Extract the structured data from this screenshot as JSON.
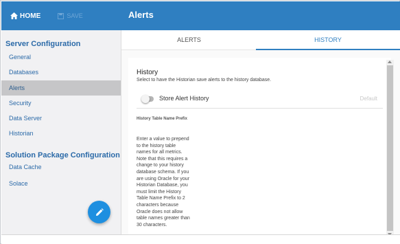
{
  "topbar": {
    "home_label": "HOME",
    "save_label": "SAVE",
    "page_title": "Alerts"
  },
  "sidebar": {
    "sections": [
      {
        "title": "Server Configuration"
      },
      {
        "title": "Solution Package Configuration"
      }
    ],
    "items": [
      {
        "label": "General"
      },
      {
        "label": "Databases"
      },
      {
        "label": "Alerts"
      },
      {
        "label": "Security"
      },
      {
        "label": "Data Server"
      },
      {
        "label": "Historian"
      },
      {
        "label": "Data Cache"
      },
      {
        "label": "Solace"
      }
    ],
    "fab_icon": "pencil-icon"
  },
  "tabs": [
    {
      "label": "ALERTS"
    },
    {
      "label": "HISTORY"
    }
  ],
  "history": {
    "title": "History",
    "description": "Select to have the Historian save alerts to the history database.",
    "toggle_label": "Store Alert History",
    "toggle_on": false,
    "default_label": "Default",
    "field_label": "History Table Name Prefix",
    "help_text": "Enter a value to prepend to the history table names for all metrics. Note that this requires a change to your history database schema. If you are using Oracle for your Historian Database, you must limit the History Table Name Prefix to 2 characters because Oracle does not allow table names greater than 30 characters."
  },
  "colors": {
    "brand": "#2f7fc1",
    "fab": "#1e8fe0",
    "active_item": "#c6c6c8"
  }
}
